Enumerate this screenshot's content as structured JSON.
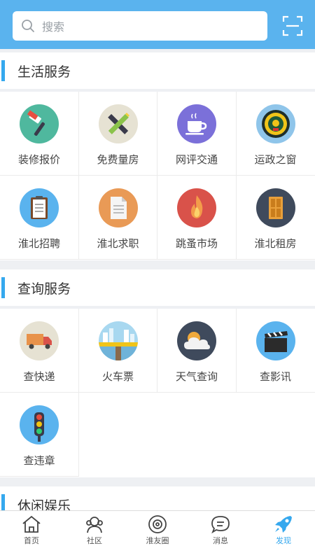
{
  "search": {
    "placeholder": "搜索"
  },
  "colors": {
    "header": "#5ab3ee",
    "accent": "#35a8ee"
  },
  "sections": [
    {
      "title": "生活服务",
      "items": [
        {
          "label": "装修报价",
          "icon": "paint-brush-icon"
        },
        {
          "label": "免费量房",
          "icon": "ruler-pencil-icon"
        },
        {
          "label": "网评交通",
          "icon": "coffee-cup-icon"
        },
        {
          "label": "运政之窗",
          "icon": "emblem-icon"
        },
        {
          "label": "淮北招聘",
          "icon": "clipboard-icon"
        },
        {
          "label": "淮北求职",
          "icon": "document-icon"
        },
        {
          "label": "跳蚤市场",
          "icon": "flame-icon"
        },
        {
          "label": "淮北租房",
          "icon": "door-icon"
        }
      ]
    },
    {
      "title": "查询服务",
      "items": [
        {
          "label": "查快递",
          "icon": "delivery-truck-icon"
        },
        {
          "label": "火车票",
          "icon": "train-city-icon"
        },
        {
          "label": "天气查询",
          "icon": "weather-cloud-icon"
        },
        {
          "label": "查影讯",
          "icon": "clapperboard-icon"
        },
        {
          "label": "查违章",
          "icon": "traffic-light-icon"
        }
      ]
    },
    {
      "title": "休闲娱乐"
    }
  ],
  "nav": [
    {
      "label": "首页",
      "icon": "home-icon",
      "active": false
    },
    {
      "label": "社区",
      "icon": "community-icon",
      "active": false
    },
    {
      "label": "淮友圈",
      "icon": "moments-icon",
      "active": false
    },
    {
      "label": "消息",
      "icon": "message-icon",
      "active": false
    },
    {
      "label": "发现",
      "icon": "rocket-icon",
      "active": true
    }
  ]
}
